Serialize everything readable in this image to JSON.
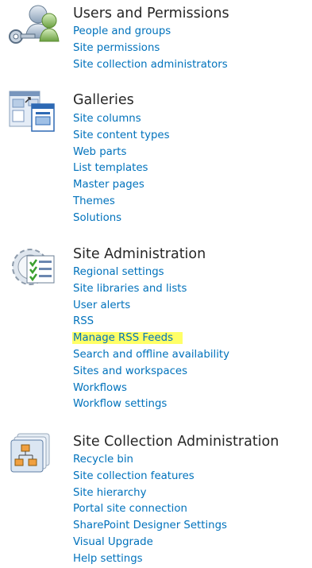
{
  "sections": [
    {
      "title": "Users and Permissions",
      "icon": "users-permissions-icon",
      "links": [
        {
          "label": "People and groups"
        },
        {
          "label": "Site permissions"
        },
        {
          "label": "Site collection administrators"
        }
      ]
    },
    {
      "title": "Galleries",
      "icon": "galleries-icon",
      "links": [
        {
          "label": "Site columns"
        },
        {
          "label": "Site content types"
        },
        {
          "label": "Web parts"
        },
        {
          "label": "List templates"
        },
        {
          "label": "Master pages"
        },
        {
          "label": "Themes"
        },
        {
          "label": "Solutions"
        }
      ]
    },
    {
      "title": "Site Administration",
      "icon": "site-administration-icon",
      "links": [
        {
          "label": "Regional settings"
        },
        {
          "label": "Site libraries and lists"
        },
        {
          "label": "User alerts"
        },
        {
          "label": "RSS"
        },
        {
          "label": "Manage RSS Feeds",
          "highlighted": true
        },
        {
          "label": "Search and offline availability"
        },
        {
          "label": "Sites and workspaces"
        },
        {
          "label": "Workflows"
        },
        {
          "label": "Workflow settings"
        }
      ]
    },
    {
      "title": "Site Collection Administration",
      "icon": "site-collection-administration-icon",
      "links": [
        {
          "label": "Recycle bin"
        },
        {
          "label": "Site collection features"
        },
        {
          "label": "Site hierarchy"
        },
        {
          "label": "Portal site connection"
        },
        {
          "label": "SharePoint Designer Settings"
        },
        {
          "label": "Visual Upgrade"
        },
        {
          "label": "Help settings"
        }
      ]
    }
  ],
  "colors": {
    "link": "#0072bc",
    "title": "#262626",
    "highlight": "#ffff66"
  }
}
